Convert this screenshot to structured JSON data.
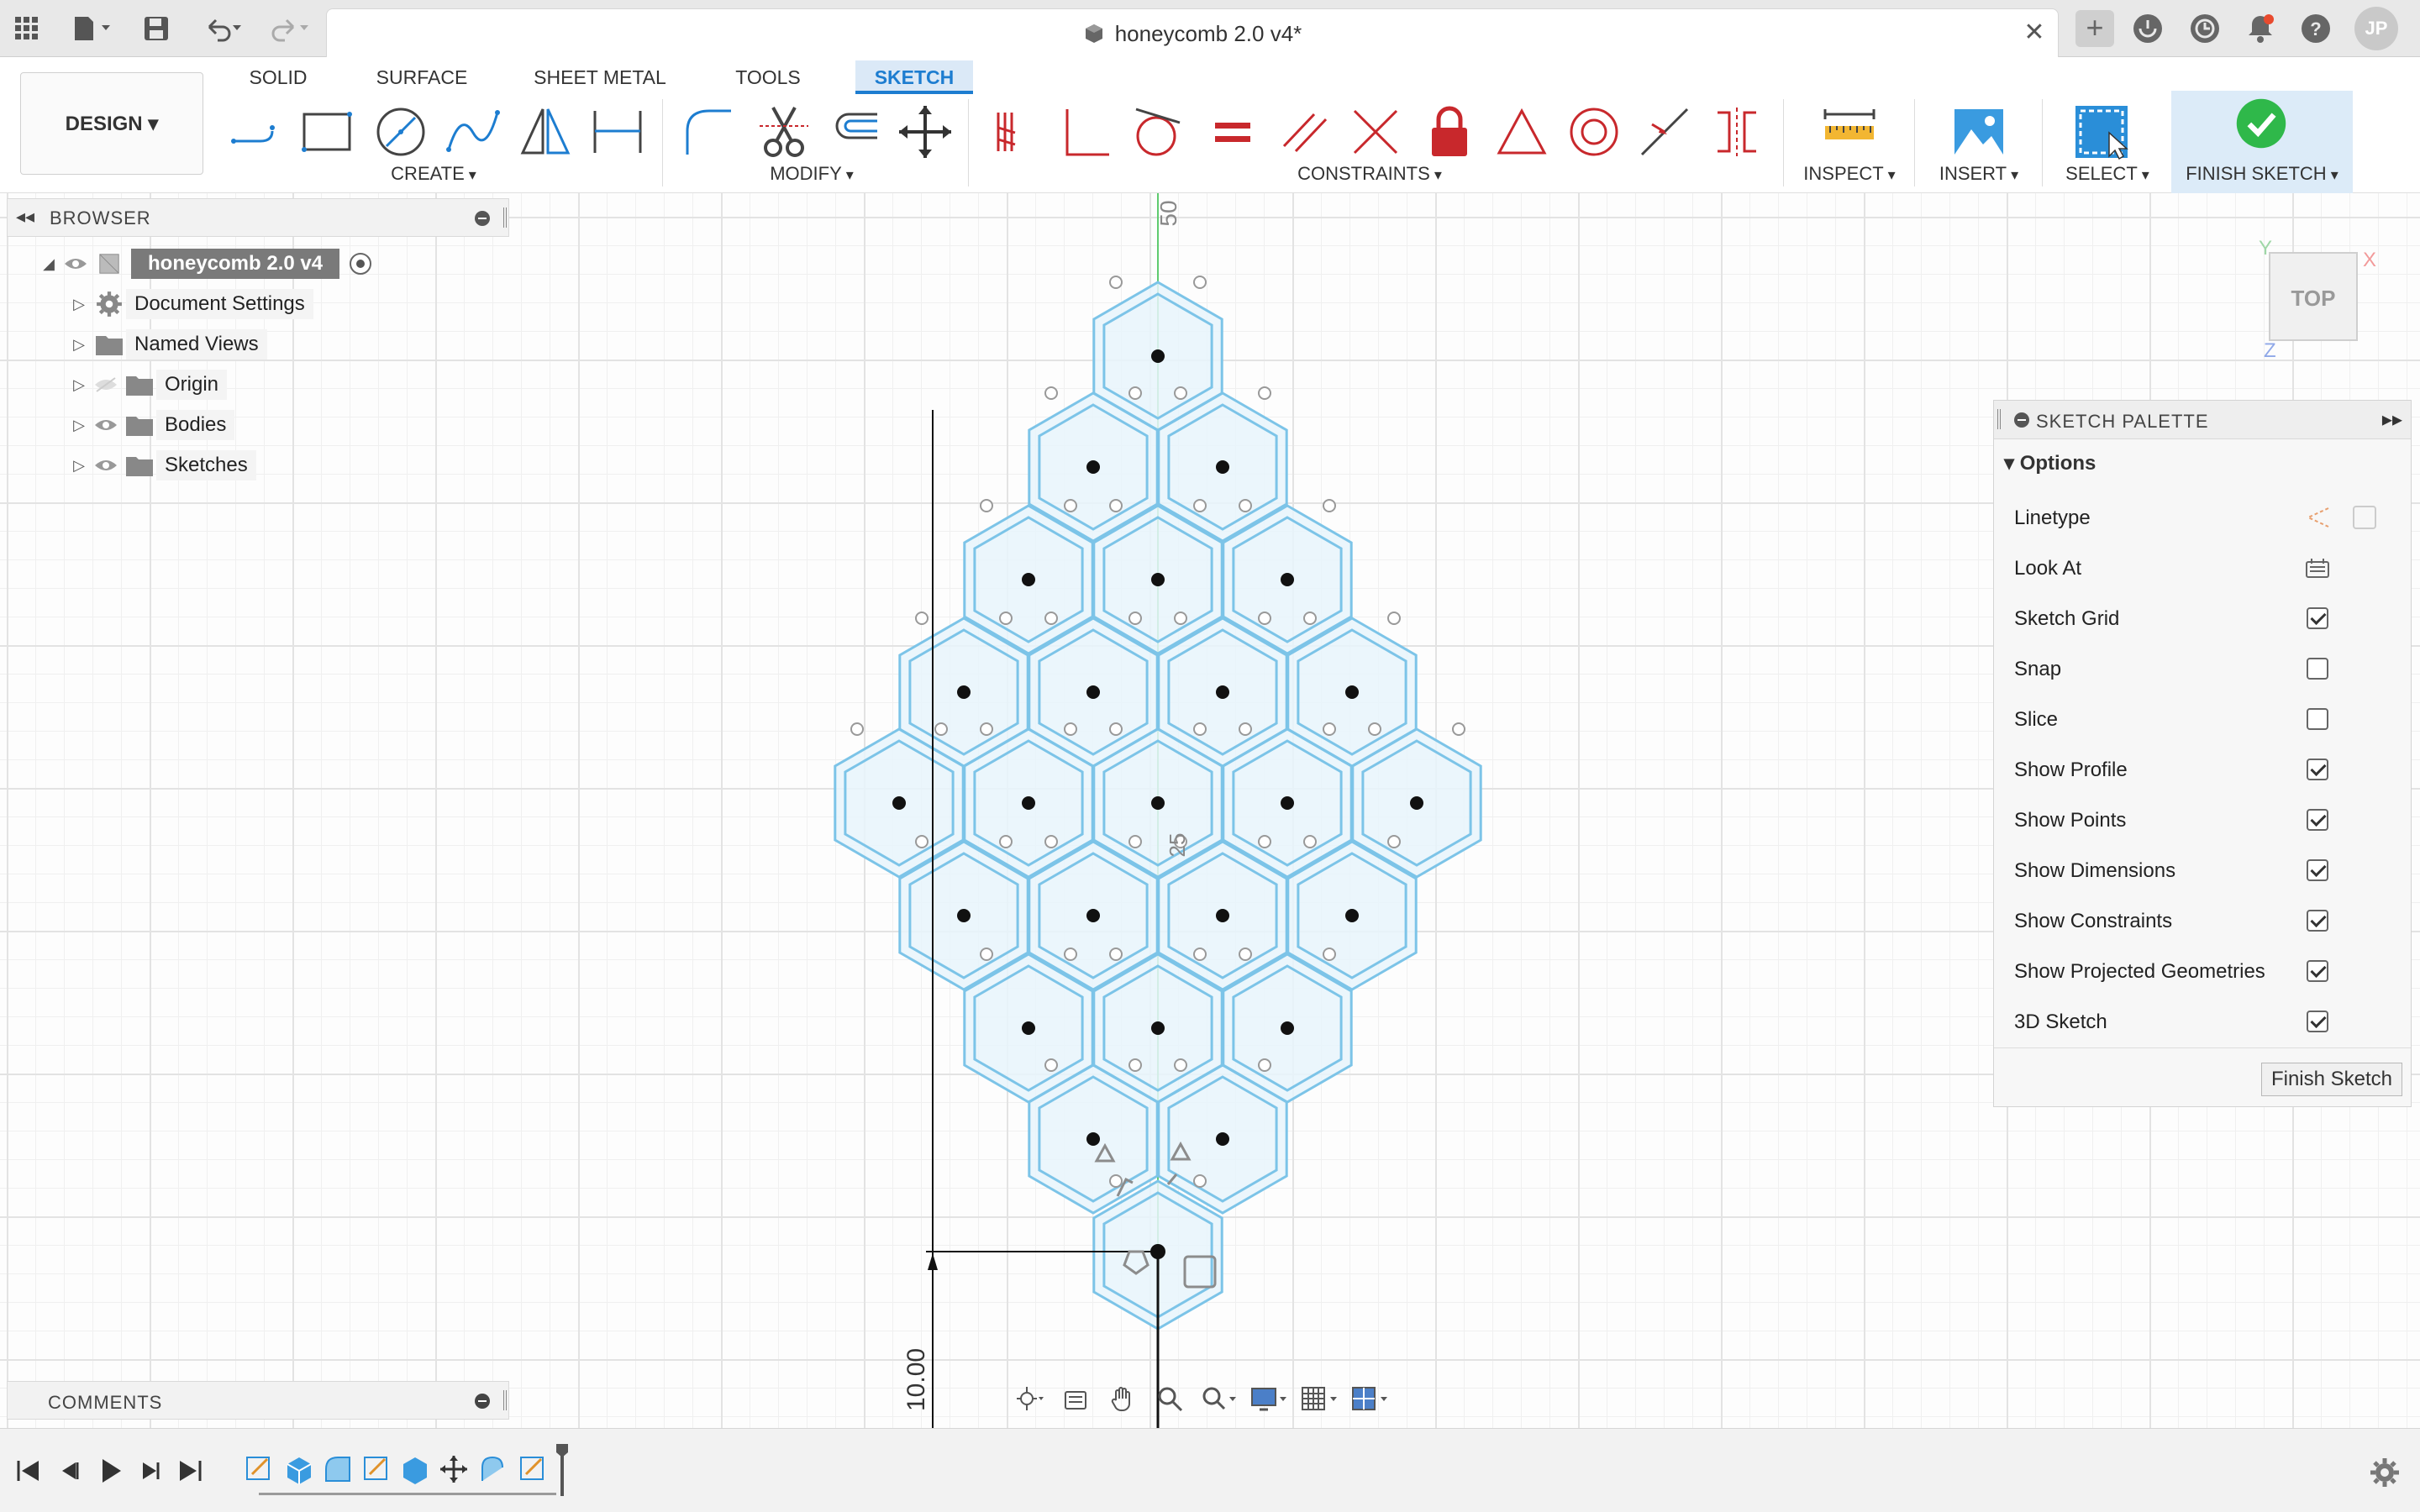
{
  "title_bar": {
    "document_title": "honeycomb 2.0 v4*",
    "user_initials": "JP",
    "icons": [
      "grid-apps-icon",
      "file-icon",
      "save-icon",
      "undo-icon",
      "redo-icon",
      "close-icon",
      "plus-icon",
      "extensions-icon",
      "job-status-icon",
      "notifications-icon",
      "help-icon"
    ]
  },
  "toolbar": {
    "workspace": "DESIGN",
    "tabs": [
      "SOLID",
      "SURFACE",
      "SHEET METAL",
      "TOOLS",
      "SKETCH"
    ],
    "active_tab": "SKETCH",
    "groups": {
      "create": "CREATE",
      "modify": "MODIFY",
      "constraints": "CONSTRAINTS",
      "inspect": "INSPECT",
      "insert": "INSERT",
      "select": "SELECT",
      "finish_sketch": "FINISH SKETCH"
    },
    "accent_color": "#1d7dd0",
    "constraint_color": "#c8282c",
    "finish_color": "#2fb84a"
  },
  "browser": {
    "title": "BROWSER",
    "root": "honeycomb 2.0 v4",
    "items": [
      {
        "label": "Document Settings",
        "icon": "gear-icon"
      },
      {
        "label": "Named Views",
        "icon": "folder-icon"
      },
      {
        "label": "Origin",
        "icon": "folder-icon"
      },
      {
        "label": "Bodies",
        "icon": "folder-icon"
      },
      {
        "label": "Sketches",
        "icon": "folder-icon"
      }
    ]
  },
  "comments": {
    "title": "COMMENTS"
  },
  "canvas": {
    "dimension_top": "50",
    "dimension_center": "25",
    "dimension_left": "10.00",
    "profile_color": "#7cc4e8",
    "fill_color": "#e8f4fb"
  },
  "viewcube": {
    "face": "TOP",
    "x_axis": "X",
    "y_axis": "Y",
    "z_axis": "Z"
  },
  "sketch_palette": {
    "title": "SKETCH PALETTE",
    "section": "Options",
    "options": [
      {
        "label": "Linetype",
        "type": "icons"
      },
      {
        "label": "Look At",
        "type": "icon"
      },
      {
        "label": "Sketch Grid",
        "checked": true
      },
      {
        "label": "Snap",
        "checked": false
      },
      {
        "label": "Slice",
        "checked": false
      },
      {
        "label": "Show Profile",
        "checked": true
      },
      {
        "label": "Show Points",
        "checked": true
      },
      {
        "label": "Show Dimensions",
        "checked": true
      },
      {
        "label": "Show Constraints",
        "checked": true
      },
      {
        "label": "Show Projected Geometries",
        "checked": true
      },
      {
        "label": "3D Sketch",
        "checked": true
      }
    ],
    "finish_button": "Finish Sketch"
  }
}
